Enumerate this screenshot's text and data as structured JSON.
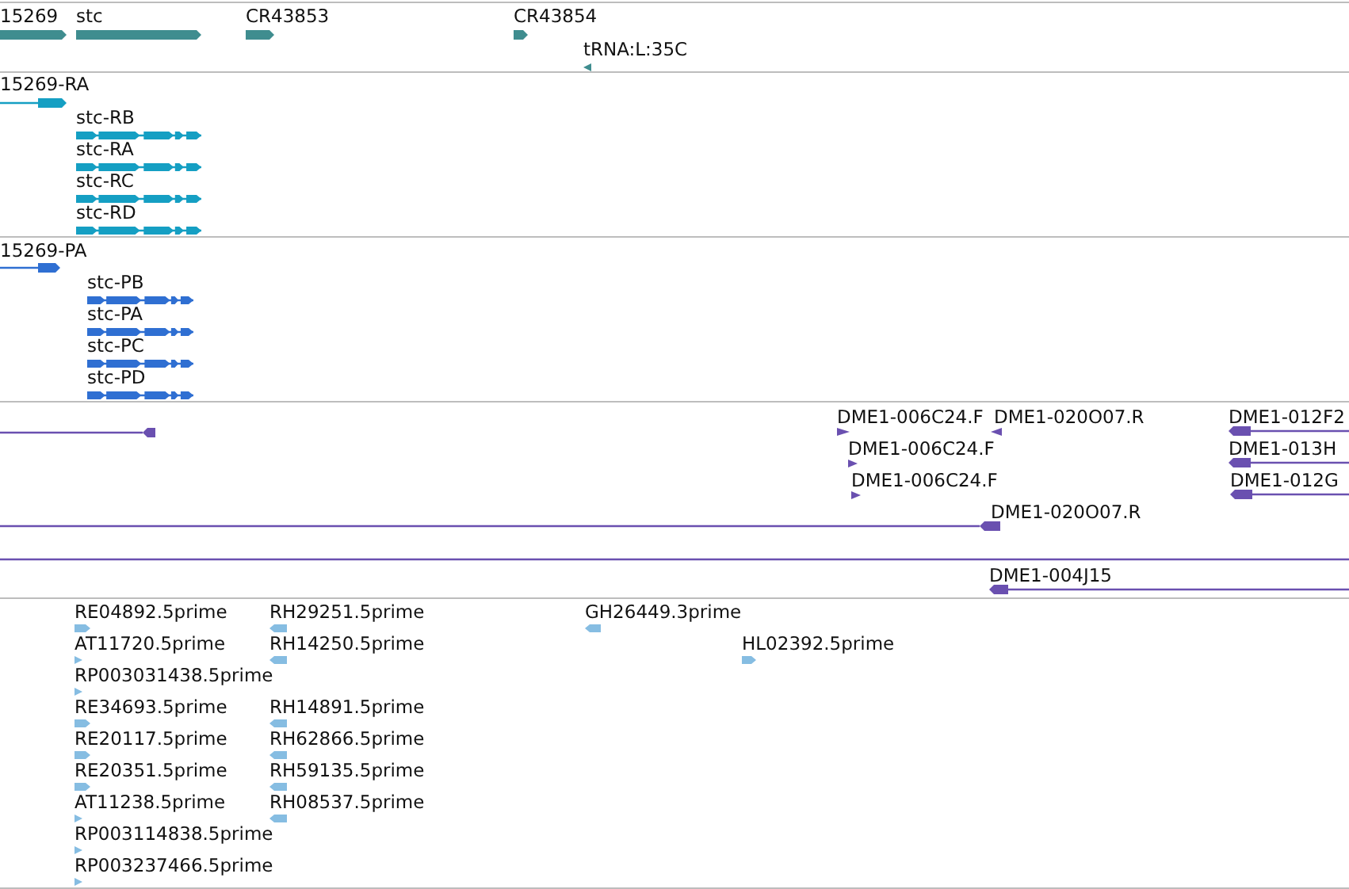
{
  "tracks": [
    {
      "kind": "gene",
      "features": [
        {
          "label": "15269",
          "reverse": false
        },
        {
          "label": "stc",
          "reverse": false
        },
        {
          "label": "CR43853",
          "reverse": false
        },
        {
          "label": "CR43854",
          "reverse": false
        },
        {
          "label": "tRNA:L:35C",
          "reverse": true
        }
      ]
    },
    {
      "kind": "transcript",
      "features": [
        {
          "label": "15269-RA",
          "reverse": false
        },
        {
          "label": "stc-RB",
          "reverse": false
        },
        {
          "label": "stc-RA",
          "reverse": false
        },
        {
          "label": "stc-RC",
          "reverse": false
        },
        {
          "label": "stc-RD",
          "reverse": false
        }
      ]
    },
    {
      "kind": "protein",
      "features": [
        {
          "label": "15269-PA",
          "reverse": false
        },
        {
          "label": "stc-PB",
          "reverse": false
        },
        {
          "label": "stc-PA",
          "reverse": false
        },
        {
          "label": "stc-PC",
          "reverse": false
        },
        {
          "label": "stc-PD",
          "reverse": false
        }
      ]
    },
    {
      "kind": "clone",
      "features": [
        {
          "reverse": true
        },
        {
          "label": "DME1-006C24.F",
          "reverse": false
        },
        {
          "label": "DME1-020O07.R",
          "reverse": true
        },
        {
          "label": "DME1-012F2",
          "reverse": true
        },
        {
          "label": "DME1-006C24.F",
          "reverse": false
        },
        {
          "label": "DME1-013H",
          "reverse": true
        },
        {
          "label": "DME1-006C24.F",
          "reverse": false
        },
        {
          "label": "DME1-012G",
          "reverse": true
        },
        {
          "label": "DME1-020O07.R",
          "reverse": true
        },
        {
          "kind": "line"
        },
        {
          "label": "DME1-004J15",
          "reverse": true
        }
      ]
    },
    {
      "kind": "est",
      "features": [
        {
          "label": "RE04892.5prime",
          "reverse": false
        },
        {
          "label": "RH29251.5prime",
          "reverse": true
        },
        {
          "label": "GH26449.3prime",
          "reverse": true
        },
        {
          "label": "AT11720.5prime",
          "reverse": false
        },
        {
          "label": "RH14250.5prime",
          "reverse": true
        },
        {
          "label": "HL02392.5prime",
          "reverse": false
        },
        {
          "label": "RP003031438.5prime",
          "reverse": false
        },
        {
          "label": "RE34693.5prime",
          "reverse": false
        },
        {
          "label": "RH14891.5prime",
          "reverse": true
        },
        {
          "label": "RE20117.5prime",
          "reverse": false
        },
        {
          "label": "RH62866.5prime",
          "reverse": true
        },
        {
          "label": "RE20351.5prime",
          "reverse": false
        },
        {
          "label": "RH59135.5prime",
          "reverse": true
        },
        {
          "label": "AT11238.5prime",
          "reverse": false
        },
        {
          "label": "RH08537.5prime",
          "reverse": true
        },
        {
          "label": "RP003114838.5prime",
          "reverse": false
        },
        {
          "label": "RP003237466.5prime",
          "reverse": false
        }
      ]
    }
  ]
}
